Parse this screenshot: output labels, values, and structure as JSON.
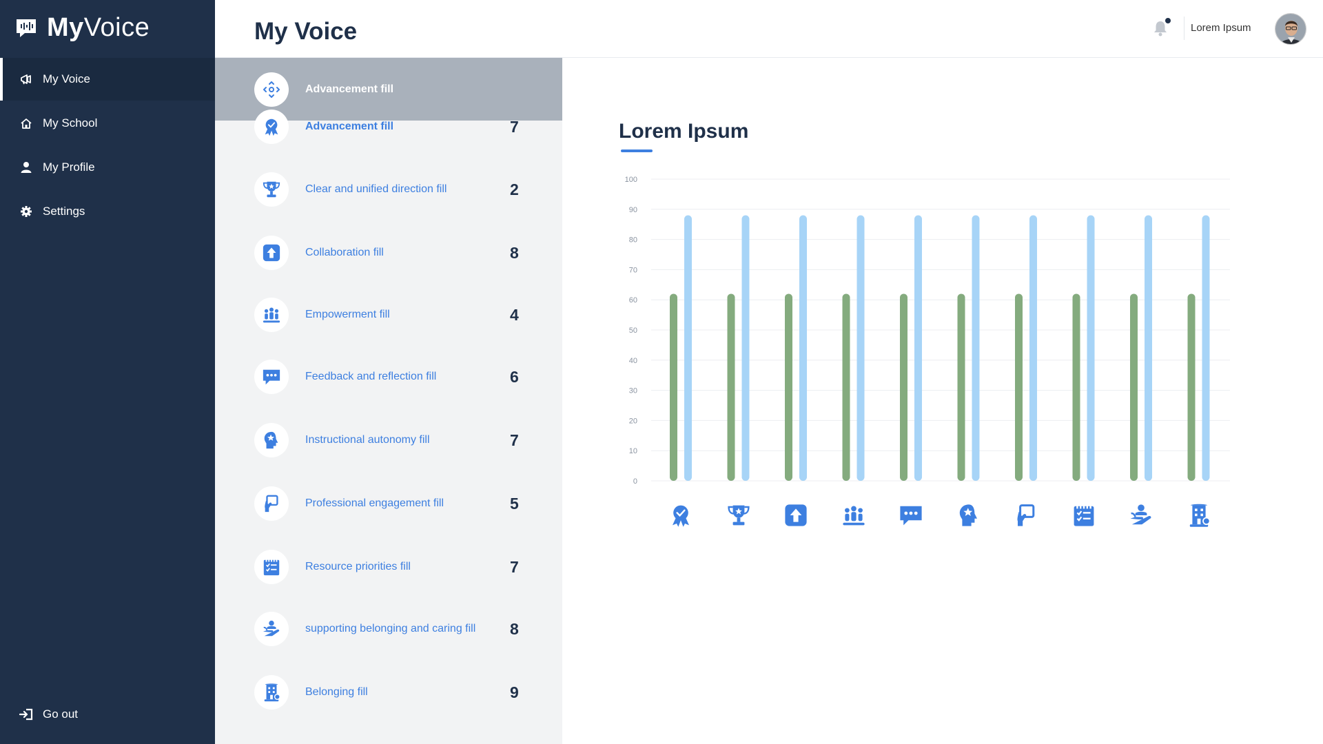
{
  "app": {
    "brand_bold": "My",
    "brand_light": "Voice"
  },
  "sidebar": {
    "items": [
      {
        "label": "My Voice",
        "icon": "megaphone-icon",
        "active": true
      },
      {
        "label": "My School",
        "icon": "home-icon"
      },
      {
        "label": "My Profile",
        "icon": "user-icon"
      },
      {
        "label": "Settings",
        "icon": "gear-icon"
      }
    ],
    "logout_label": "Go out"
  },
  "header": {
    "title": "My Voice",
    "user_name": "Lorem Ipsum"
  },
  "list": {
    "header_label": "Advancement fill",
    "items": [
      {
        "label": "Advancement fill",
        "count": "7",
        "icon": "medal-icon"
      },
      {
        "label": "Clear and unified direction fill",
        "count": "2",
        "icon": "trophy-icon"
      },
      {
        "label": "Collaboration fill",
        "count": "8",
        "icon": "upload-icon"
      },
      {
        "label": "Empowerment fill",
        "count": "4",
        "icon": "group-icon"
      },
      {
        "label": "Feedback and reflection fill",
        "count": "6",
        "icon": "chat-icon"
      },
      {
        "label": "Instructional autonomy fill",
        "count": "7",
        "icon": "star-head-icon"
      },
      {
        "label": "Professional engagement fill",
        "count": "5",
        "icon": "hand-icon"
      },
      {
        "label": "Resource priorities fill",
        "count": "7",
        "icon": "checklist-icon"
      },
      {
        "label": "supporting belonging and caring fill",
        "count": "8",
        "icon": "hand-care-icon"
      },
      {
        "label": "Belonging fill",
        "count": "9",
        "icon": "building-icon"
      }
    ]
  },
  "chart_title": "Lorem Ipsum",
  "colors": {
    "sidebar": "#1f3049",
    "accent": "#3d7fe0",
    "green_bar": "#84ab7e",
    "blue_bar": "#a7d4f7"
  },
  "chart_data": {
    "type": "bar",
    "y_ticks": [
      "0",
      "10",
      "20",
      "30",
      "40",
      "50",
      "60",
      "70",
      "80",
      "90",
      "100"
    ],
    "ylim": [
      0,
      100
    ],
    "categories_icons": [
      "medal-icon",
      "trophy-icon",
      "upload-icon",
      "group-icon",
      "chat-icon",
      "star-head-icon",
      "hand-icon",
      "checklist-icon",
      "hand-care-icon",
      "building-icon"
    ],
    "series": [
      {
        "color": "#84ab7e",
        "values": [
          62,
          62,
          62,
          62,
          62,
          62,
          62,
          62,
          62,
          62
        ]
      },
      {
        "color": "#a7d4f7",
        "values": [
          88,
          88,
          88,
          88,
          88,
          88,
          88,
          88,
          88,
          88
        ]
      }
    ],
    "grid": true
  }
}
